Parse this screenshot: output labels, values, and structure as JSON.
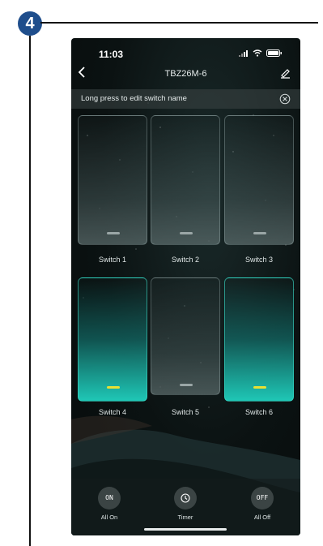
{
  "step": {
    "number": "4"
  },
  "status_bar": {
    "time": "11:03"
  },
  "header": {
    "back_icon": "chevron-left-icon",
    "title": "TBZ26M-6",
    "edit_icon": "pencil-icon"
  },
  "info_bar": {
    "text": "Long press to edit switch name",
    "close_icon": "close-circle-icon"
  },
  "switches": [
    {
      "label": "Switch 1",
      "state": "off"
    },
    {
      "label": "Switch 2",
      "state": "off"
    },
    {
      "label": "Switch 3",
      "state": "off"
    },
    {
      "label": "Switch 4",
      "state": "on"
    },
    {
      "label": "Switch 5",
      "state": "off"
    },
    {
      "label": "Switch 6",
      "state": "on"
    }
  ],
  "bottom_bar": {
    "all_on": {
      "icon_text": "ON",
      "label": "All On"
    },
    "timer": {
      "icon": "clock-icon",
      "label": "Timer"
    },
    "all_off": {
      "icon_text": "OFF",
      "label": "All Off"
    }
  },
  "colors": {
    "accent_on": "#1fc7b6",
    "indicator_on": "#e8e033",
    "badge": "#1f4e8c"
  }
}
